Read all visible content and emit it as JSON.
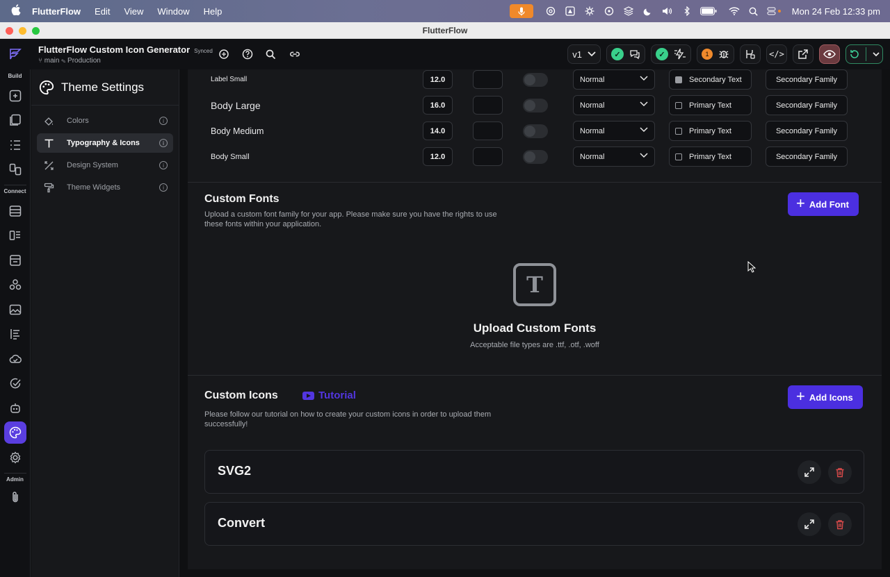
{
  "menubar": {
    "app": "FlutterFlow",
    "items": [
      "Edit",
      "View",
      "Window",
      "Help"
    ],
    "clock": "Mon 24 Feb  12:33 pm"
  },
  "window": {
    "title": "FlutterFlow"
  },
  "project": {
    "name": "FlutterFlow Custom Icon Generator",
    "status": "Synced",
    "branch": "main",
    "environment": "Production"
  },
  "toolbar": {
    "version": "v1",
    "issues_count": "1"
  },
  "rail": {
    "sections": {
      "build": "Build",
      "connect": "Connect",
      "admin": "Admin"
    }
  },
  "sidebar": {
    "title": "Theme Settings",
    "items": [
      {
        "label": "Colors"
      },
      {
        "label": "Typography & Icons"
      },
      {
        "label": "Design System"
      },
      {
        "label": "Theme Widgets"
      }
    ]
  },
  "typography": {
    "rows": [
      {
        "name": "Label Small",
        "size": "12.0",
        "weight": "Normal",
        "color": "Secondary Text",
        "family": "Secondary Family"
      },
      {
        "name": "Body Large",
        "size": "16.0",
        "weight": "Normal",
        "color": "Primary Text",
        "family": "Secondary Family"
      },
      {
        "name": "Body Medium",
        "size": "14.0",
        "weight": "Normal",
        "color": "Primary Text",
        "family": "Secondary Family"
      },
      {
        "name": "Body Small",
        "size": "12.0",
        "weight": "Normal",
        "color": "Primary Text",
        "family": "Secondary Family"
      }
    ]
  },
  "custom_fonts": {
    "title": "Custom Fonts",
    "description": "Upload a custom font family for your app. Please make sure you have the rights to use these fonts within your application.",
    "add_label": "Add Font",
    "upload_title": "Upload Custom Fonts",
    "upload_sub": "Acceptable file types are .ttf, .otf, .woff"
  },
  "custom_icons": {
    "title": "Custom Icons",
    "tutorial": "Tutorial",
    "description": "Please follow our tutorial on how to create your custom icons in order to upload them successfully!",
    "add_label": "Add Icons",
    "items": [
      {
        "name": "SVG2"
      },
      {
        "name": "Convert"
      }
    ]
  },
  "colors": {
    "accent": "#4b2fe0",
    "success": "#39d08b",
    "warning": "#f08a2c",
    "danger": "#d94a4a"
  }
}
